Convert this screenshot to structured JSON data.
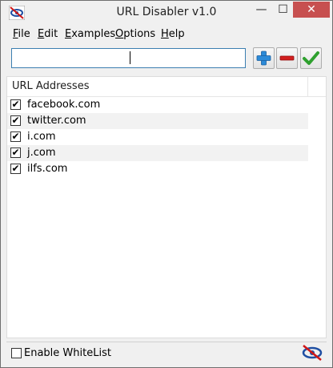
{
  "window": {
    "title": "URL Disabler v1.0",
    "min_glyph": "—",
    "max_glyph": "☐",
    "close_glyph": "✕"
  },
  "menu": [
    {
      "label": "File",
      "mnemonic": "F",
      "rest": "ile"
    },
    {
      "label": "Edit",
      "mnemonic": "E",
      "rest": "dit"
    },
    {
      "label": "Examples",
      "mnemonic": "E",
      "rest": "xamples"
    },
    {
      "label": "Options",
      "mnemonic": "O",
      "rest": "ptions"
    },
    {
      "label": "Help",
      "mnemonic": "H",
      "rest": "elp"
    }
  ],
  "url_input": {
    "value": ""
  },
  "list": {
    "header": "URL Addresses",
    "rows": [
      {
        "url": "facebook.com",
        "checked": true
      },
      {
        "url": "twitter.com",
        "checked": true
      },
      {
        "url": "i.com",
        "checked": true
      },
      {
        "url": "j.com",
        "checked": true
      },
      {
        "url": "ilfs.com",
        "checked": true
      }
    ]
  },
  "status": {
    "whitelist_label": "Enable WhiteList",
    "whitelist_checked": false
  },
  "check_glyph": "✔",
  "colors": {
    "close_bg": "#c75050",
    "add": "#2b8ad8",
    "remove": "#d21e1e",
    "apply": "#2ea02e"
  }
}
